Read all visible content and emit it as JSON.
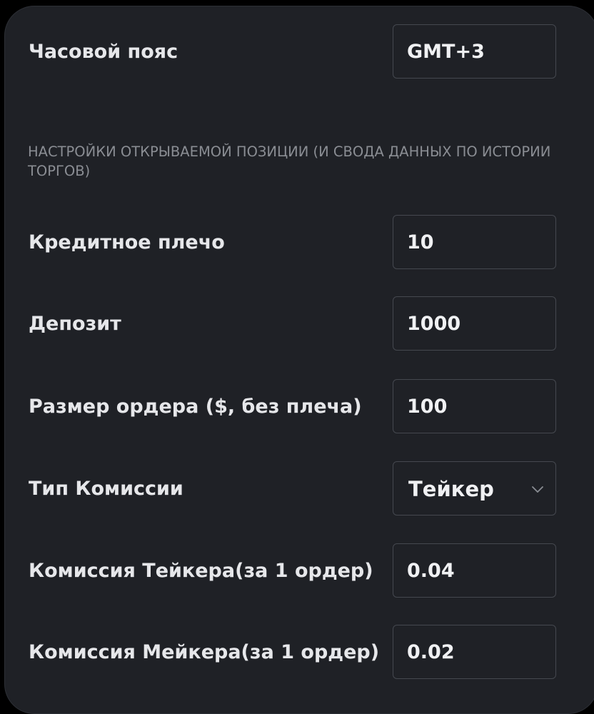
{
  "timezone": {
    "label": "Часовой пояс",
    "value": "GMT+3"
  },
  "section": {
    "title": "НАСТРОЙКИ ОТКРЫВАЕМОЙ ПОЗИЦИИ (И СВОДА ДАННЫХ ПО ИСТОРИИ ТОРГОВ)"
  },
  "leverage": {
    "label": "Кредитное плечо",
    "value": "10"
  },
  "deposit": {
    "label": "Депозит",
    "value": "1000"
  },
  "order_size": {
    "label": "Размер ордера ($, без плеча)",
    "value": "100"
  },
  "fee_type": {
    "label": "Тип Комиссии",
    "value": "Тейкер",
    "icon": "chevron-down-icon"
  },
  "taker_fee": {
    "label": "Комиссия Тейкера(за 1 ордер)",
    "value": "0.04"
  },
  "maker_fee": {
    "label": "Комиссия Мейкера(за 1 ордер)",
    "value": "0.02"
  }
}
